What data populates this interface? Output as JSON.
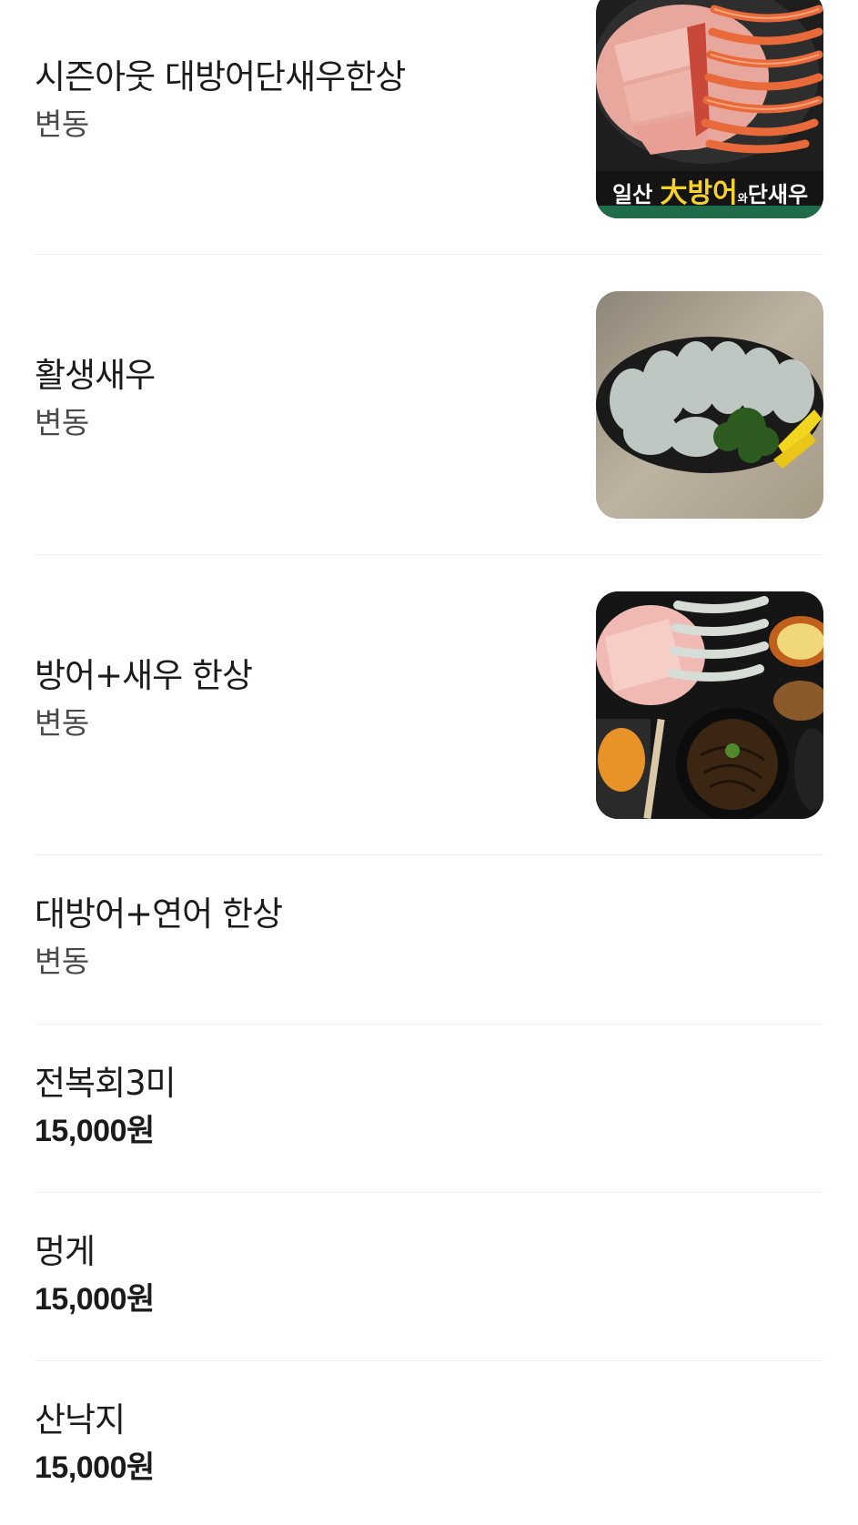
{
  "menu": {
    "items": [
      {
        "name": "시즌아웃 대방어단새우한상",
        "price": "변동",
        "image": "yellowtail-shrimp-platter-photo",
        "image_caption": {
          "part1": "일산",
          "part2": "大방어",
          "part3": "와",
          "part4": "단새우"
        }
      },
      {
        "name": "활생새우",
        "price": "변동",
        "image": "live-shrimp-photo"
      },
      {
        "name": "방어+새우 한상",
        "price": "변동",
        "image": "yellowtail-shrimp-set-photo"
      },
      {
        "name": "대방어+연어 한상",
        "price": "변동"
      },
      {
        "name": "전복회3미",
        "price": "15,000원"
      },
      {
        "name": "멍게",
        "price": "15,000원"
      },
      {
        "name": "산낙지",
        "price": "15,000원"
      }
    ]
  }
}
